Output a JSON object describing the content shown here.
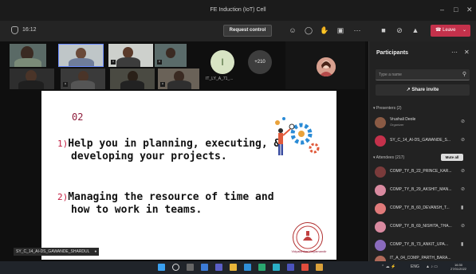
{
  "window": {
    "title": "FE Induction (IoT) Cell"
  },
  "toolbar": {
    "timer": "16:12",
    "request_control": "Request control",
    "leave": "Leave"
  },
  "gallery": {
    "avatar_initial": "I",
    "avatar_name": "IT_LY_A_71_...",
    "more_count": "+210"
  },
  "slide": {
    "number": "02",
    "point1_num": "1)",
    "point1_line1": "Help you in planning, executing, &",
    "point1_line2": "developing your projects.",
    "point2_num": "2)",
    "point2_line1": "Managing the resource of time and",
    "point2_line2": "how to work in teams.",
    "logo_text": "Vidyalankar Vidyamandir"
  },
  "presenter_tag": "SY_C_14_AI-DS_GAWANDE_SHARDUL",
  "panel": {
    "title": "Participants",
    "search_placeholder": "Type a name",
    "share_invite": "Share invite",
    "presenters_label": "Presenters (2)",
    "attendees_label": "Attendees (217)",
    "mute_all": "Mute all",
    "presenters": [
      {
        "name": "Vrushali Deole",
        "role": "Organizer",
        "color": "#8a5a44"
      },
      {
        "name": "SY_C_14_AI-DS_GAWANDE_S...",
        "role": "",
        "color": "#c4314b"
      }
    ],
    "attendees": [
      {
        "name": "COMP_TY_B_22_PRINCE_KAR...",
        "color": "#7a3b3b"
      },
      {
        "name": "COMP_TY_B_29_AKSHIT_MAN...",
        "color": "#d98aa0"
      },
      {
        "name": "COMP_TY_B_60_DEVANSH_T...",
        "color": "#e07a7a"
      },
      {
        "name": "COMP_TY_B_69_NISHITA_THA...",
        "color": "#d98aa0"
      },
      {
        "name": "COMP_TY_B_73_ANKIT_UPA...",
        "color": "#8a6bbd"
      },
      {
        "name": "IT_A_04_COMP_PARTH_BARA...",
        "color": "#b06a5a"
      }
    ]
  },
  "taskbar": {
    "lang": "ENG",
    "time": "16:30",
    "date": "27/01/2022"
  }
}
